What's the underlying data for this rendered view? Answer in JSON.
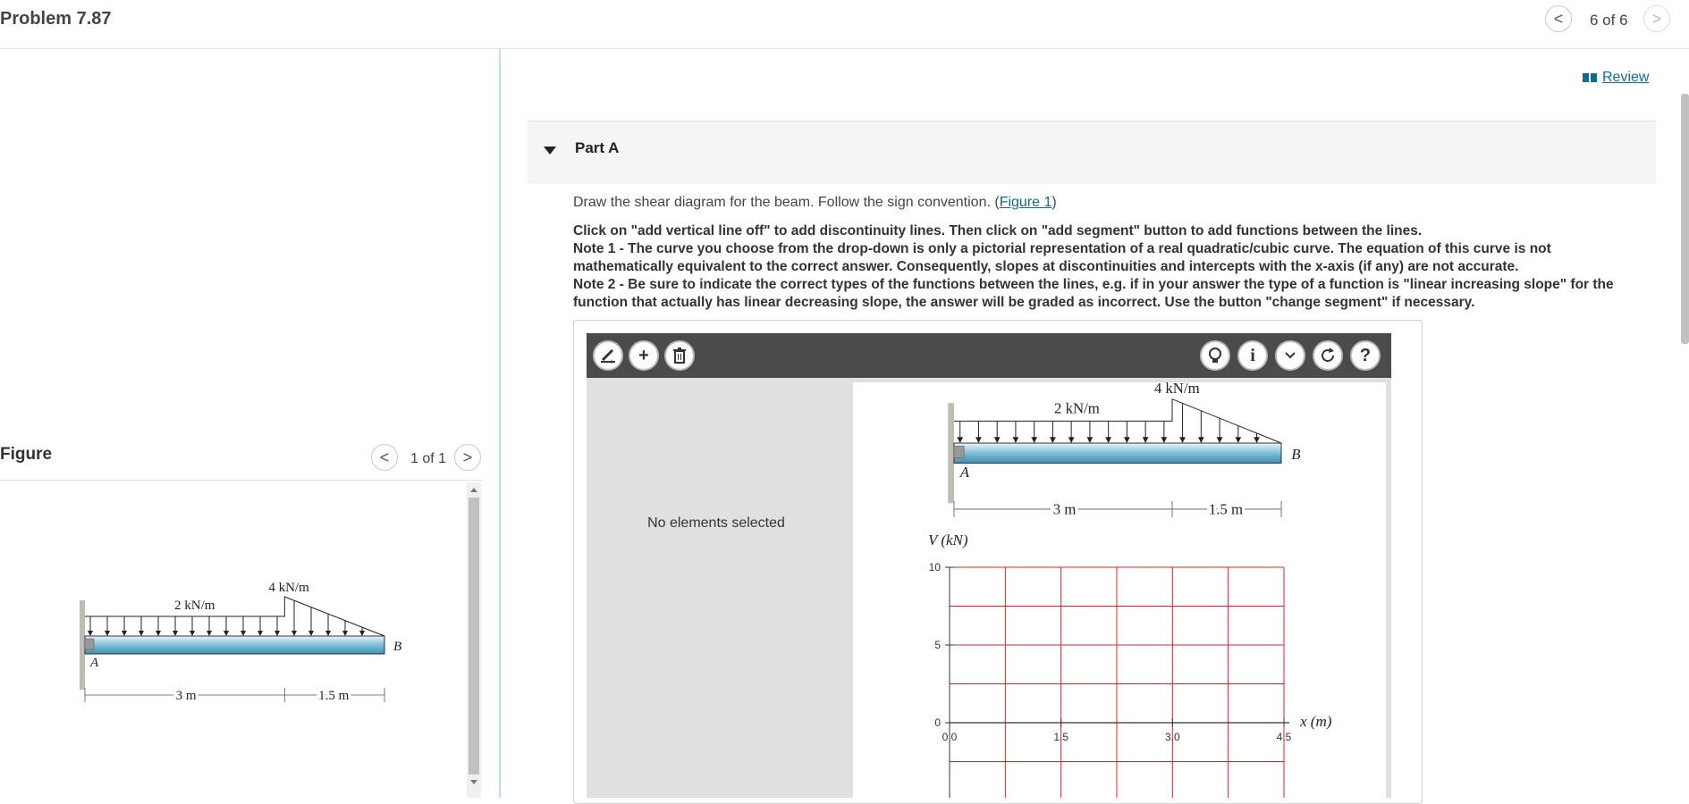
{
  "header": {
    "title": "Problem 7.87",
    "page_counter": "6 of 6",
    "prev_glyph": "<",
    "next_glyph": ">"
  },
  "review": {
    "label": "Review",
    "icon": "book-icon"
  },
  "part": {
    "label": "Part A"
  },
  "instructions": {
    "prefix": "Draw the shear diagram for the beam. Follow the sign convention. (",
    "link": "Figure 1",
    "suffix": ")",
    "note_click": "Click on \"add vertical line off\" to add discontinuity lines. Then click on \"add segment\" button to add functions between the lines.",
    "note_1": "Note 1 - The curve you choose from the drop-down is only a pictorial representation of a real quadratic/cubic curve. The equation of this curve is not mathematically equivalent to the correct answer. Consequently, slopes at discontinuities and intercepts with the x-axis (if any) are not accurate.",
    "note_2": "Note 2 - Be sure to indicate the correct types of the functions between the lines, e.g. if in your answer the type of a function is \"linear increasing slope\" for the function that actually has linear decreasing slope, the answer will be graded as incorrect. Use the button \"change segment\" if necessary."
  },
  "toolbar": {
    "left_icons": [
      "add-vertical-line-icon",
      "add-segment-icon",
      "delete-icon"
    ],
    "right_icons": [
      "hint-icon",
      "info-icon",
      "dropdown-icon",
      "reset-icon",
      "help-icon"
    ],
    "info_glyph": "i",
    "help_glyph": "?",
    "plus_glyph": "+"
  },
  "editor": {
    "status": "No elements selected"
  },
  "figure": {
    "label": "Figure",
    "counter": "1 of 1",
    "load_left": "2 kN/m",
    "load_right": "4 kN/m",
    "support_label": "A",
    "end_label": "B",
    "span_1": "3 m",
    "span_2": "1.5 m"
  },
  "chart_data": {
    "type": "line",
    "title": "",
    "xlabel": "x (m)",
    "ylabel": "V (kN)",
    "xlim": [
      0,
      4.5
    ],
    "ylim": [
      -5,
      10
    ],
    "x_ticks": [
      "0.0",
      "1.5",
      "3.0",
      "4.5"
    ],
    "y_ticks": [
      "10",
      "5",
      "0"
    ],
    "grid": true,
    "grid_color": "#e02020",
    "series": []
  },
  "colors": {
    "toolbar_bg": "#4b4b4b",
    "link": "#0e6d96",
    "grid": "#e02020",
    "beam": "#7fbfd8"
  }
}
